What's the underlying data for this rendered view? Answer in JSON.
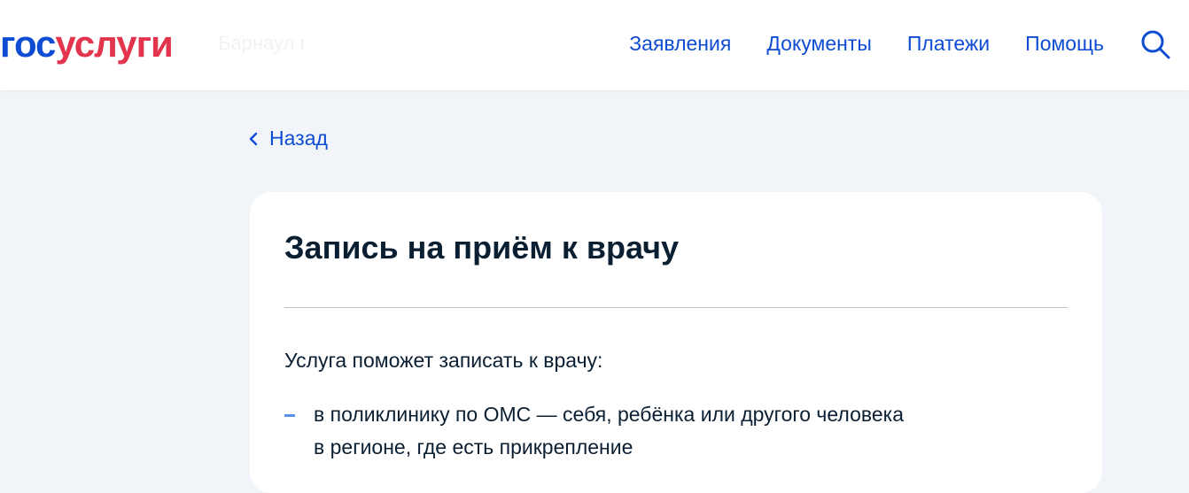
{
  "header": {
    "logo": {
      "part_a": "гос",
      "part_b": "услуги"
    },
    "location": "Барнаул г",
    "nav": [
      {
        "label": "Заявления"
      },
      {
        "label": "Документы"
      },
      {
        "label": "Платежи"
      },
      {
        "label": "Помощь"
      }
    ],
    "search_icon": "search-icon"
  },
  "back": {
    "label": "Назад",
    "icon": "chevron-left-icon"
  },
  "card": {
    "title": "Запись на приём к врачу",
    "intro": "Услуга поможет записать к врачу:",
    "bullets": [
      {
        "line1": "в поликлинику по ОМС — себя, ребёнка или другого человека",
        "line2": "в регионе, где есть прикрепление"
      }
    ]
  },
  "colors": {
    "brand_blue": "#0d4cd3",
    "brand_red": "#e2344c",
    "background": "#f1f4f8",
    "text": "#0b1f33",
    "bullet": "#5a8ff0"
  }
}
